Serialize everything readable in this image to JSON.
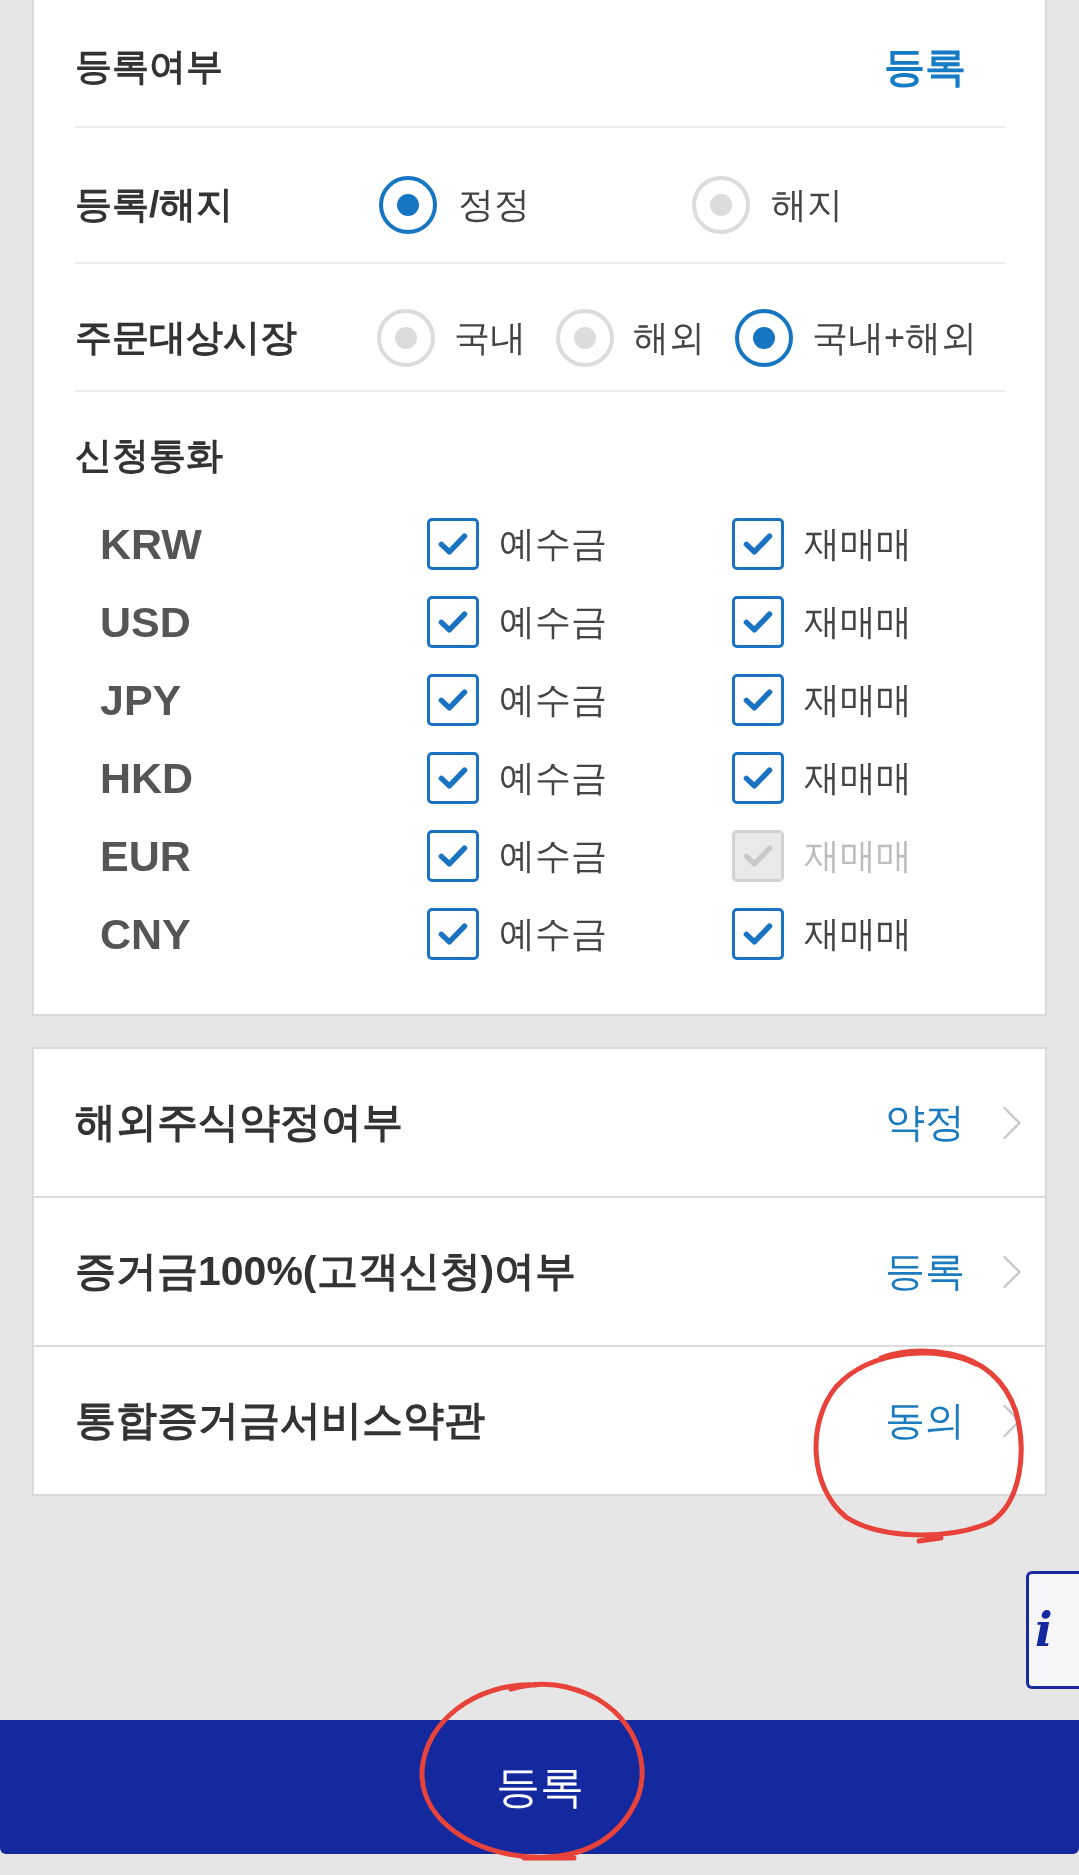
{
  "registration_status": {
    "label": "등록여부",
    "value": "등록"
  },
  "register_cancel": {
    "label": "등록/해지",
    "options": [
      {
        "label": "정정",
        "selected": true
      },
      {
        "label": "해지",
        "selected": false
      }
    ]
  },
  "target_market": {
    "label": "주문대상시장",
    "options": [
      {
        "label": "국내",
        "selected": false
      },
      {
        "label": "해외",
        "selected": false
      },
      {
        "label": "국내+해외",
        "selected": true
      }
    ]
  },
  "currencies": {
    "label": "신청통화",
    "rows": [
      {
        "code": "KRW",
        "options": [
          {
            "label": "예수금",
            "checked": true,
            "disabled": false
          },
          {
            "label": "재매매",
            "checked": true,
            "disabled": false
          }
        ]
      },
      {
        "code": "USD",
        "options": [
          {
            "label": "예수금",
            "checked": true,
            "disabled": false
          },
          {
            "label": "재매매",
            "checked": true,
            "disabled": false
          }
        ]
      },
      {
        "code": "JPY",
        "options": [
          {
            "label": "예수금",
            "checked": true,
            "disabled": false
          },
          {
            "label": "재매매",
            "checked": true,
            "disabled": false
          }
        ]
      },
      {
        "code": "HKD",
        "options": [
          {
            "label": "예수금",
            "checked": true,
            "disabled": false
          },
          {
            "label": "재매매",
            "checked": true,
            "disabled": false
          }
        ]
      },
      {
        "code": "EUR",
        "options": [
          {
            "label": "예수금",
            "checked": true,
            "disabled": false
          },
          {
            "label": "재매매",
            "checked": true,
            "disabled": true
          }
        ]
      },
      {
        "code": "CNY",
        "options": [
          {
            "label": "예수금",
            "checked": true,
            "disabled": false
          },
          {
            "label": "재매매",
            "checked": true,
            "disabled": false
          }
        ]
      }
    ]
  },
  "settings": [
    {
      "label": "해외주식약정여부",
      "value": "약정",
      "circled": false
    },
    {
      "label": "증거금100%(고객신청)여부",
      "value": "등록",
      "circled": false
    },
    {
      "label": "통합증거금서비스약관",
      "value": "동의",
      "circled": true
    }
  ],
  "info_button": {
    "label": "i"
  },
  "submit_button": {
    "label": "등록",
    "circled": true
  }
}
